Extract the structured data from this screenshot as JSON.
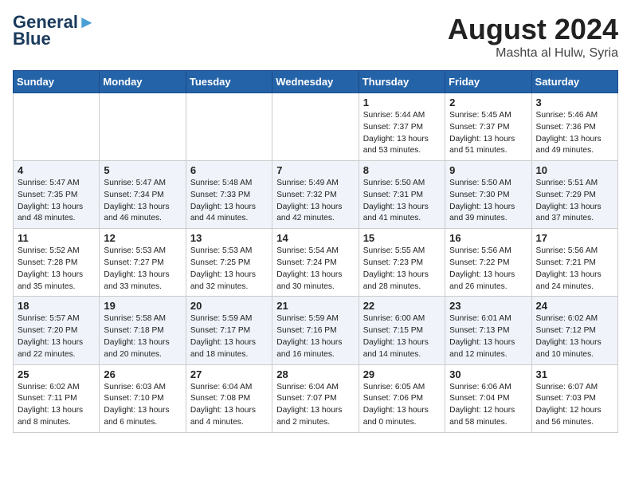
{
  "header": {
    "logo_line1": "General",
    "logo_line2": "Blue",
    "month": "August 2024",
    "location": "Mashta al Hulw, Syria"
  },
  "days_of_week": [
    "Sunday",
    "Monday",
    "Tuesday",
    "Wednesday",
    "Thursday",
    "Friday",
    "Saturday"
  ],
  "weeks": [
    [
      {
        "day": "",
        "info": ""
      },
      {
        "day": "",
        "info": ""
      },
      {
        "day": "",
        "info": ""
      },
      {
        "day": "",
        "info": ""
      },
      {
        "day": "1",
        "info": "Sunrise: 5:44 AM\nSunset: 7:37 PM\nDaylight: 13 hours\nand 53 minutes."
      },
      {
        "day": "2",
        "info": "Sunrise: 5:45 AM\nSunset: 7:37 PM\nDaylight: 13 hours\nand 51 minutes."
      },
      {
        "day": "3",
        "info": "Sunrise: 5:46 AM\nSunset: 7:36 PM\nDaylight: 13 hours\nand 49 minutes."
      }
    ],
    [
      {
        "day": "4",
        "info": "Sunrise: 5:47 AM\nSunset: 7:35 PM\nDaylight: 13 hours\nand 48 minutes."
      },
      {
        "day": "5",
        "info": "Sunrise: 5:47 AM\nSunset: 7:34 PM\nDaylight: 13 hours\nand 46 minutes."
      },
      {
        "day": "6",
        "info": "Sunrise: 5:48 AM\nSunset: 7:33 PM\nDaylight: 13 hours\nand 44 minutes."
      },
      {
        "day": "7",
        "info": "Sunrise: 5:49 AM\nSunset: 7:32 PM\nDaylight: 13 hours\nand 42 minutes."
      },
      {
        "day": "8",
        "info": "Sunrise: 5:50 AM\nSunset: 7:31 PM\nDaylight: 13 hours\nand 41 minutes."
      },
      {
        "day": "9",
        "info": "Sunrise: 5:50 AM\nSunset: 7:30 PM\nDaylight: 13 hours\nand 39 minutes."
      },
      {
        "day": "10",
        "info": "Sunrise: 5:51 AM\nSunset: 7:29 PM\nDaylight: 13 hours\nand 37 minutes."
      }
    ],
    [
      {
        "day": "11",
        "info": "Sunrise: 5:52 AM\nSunset: 7:28 PM\nDaylight: 13 hours\nand 35 minutes."
      },
      {
        "day": "12",
        "info": "Sunrise: 5:53 AM\nSunset: 7:27 PM\nDaylight: 13 hours\nand 33 minutes."
      },
      {
        "day": "13",
        "info": "Sunrise: 5:53 AM\nSunset: 7:25 PM\nDaylight: 13 hours\nand 32 minutes."
      },
      {
        "day": "14",
        "info": "Sunrise: 5:54 AM\nSunset: 7:24 PM\nDaylight: 13 hours\nand 30 minutes."
      },
      {
        "day": "15",
        "info": "Sunrise: 5:55 AM\nSunset: 7:23 PM\nDaylight: 13 hours\nand 28 minutes."
      },
      {
        "day": "16",
        "info": "Sunrise: 5:56 AM\nSunset: 7:22 PM\nDaylight: 13 hours\nand 26 minutes."
      },
      {
        "day": "17",
        "info": "Sunrise: 5:56 AM\nSunset: 7:21 PM\nDaylight: 13 hours\nand 24 minutes."
      }
    ],
    [
      {
        "day": "18",
        "info": "Sunrise: 5:57 AM\nSunset: 7:20 PM\nDaylight: 13 hours\nand 22 minutes."
      },
      {
        "day": "19",
        "info": "Sunrise: 5:58 AM\nSunset: 7:18 PM\nDaylight: 13 hours\nand 20 minutes."
      },
      {
        "day": "20",
        "info": "Sunrise: 5:59 AM\nSunset: 7:17 PM\nDaylight: 13 hours\nand 18 minutes."
      },
      {
        "day": "21",
        "info": "Sunrise: 5:59 AM\nSunset: 7:16 PM\nDaylight: 13 hours\nand 16 minutes."
      },
      {
        "day": "22",
        "info": "Sunrise: 6:00 AM\nSunset: 7:15 PM\nDaylight: 13 hours\nand 14 minutes."
      },
      {
        "day": "23",
        "info": "Sunrise: 6:01 AM\nSunset: 7:13 PM\nDaylight: 13 hours\nand 12 minutes."
      },
      {
        "day": "24",
        "info": "Sunrise: 6:02 AM\nSunset: 7:12 PM\nDaylight: 13 hours\nand 10 minutes."
      }
    ],
    [
      {
        "day": "25",
        "info": "Sunrise: 6:02 AM\nSunset: 7:11 PM\nDaylight: 13 hours\nand 8 minutes."
      },
      {
        "day": "26",
        "info": "Sunrise: 6:03 AM\nSunset: 7:10 PM\nDaylight: 13 hours\nand 6 minutes."
      },
      {
        "day": "27",
        "info": "Sunrise: 6:04 AM\nSunset: 7:08 PM\nDaylight: 13 hours\nand 4 minutes."
      },
      {
        "day": "28",
        "info": "Sunrise: 6:04 AM\nSunset: 7:07 PM\nDaylight: 13 hours\nand 2 minutes."
      },
      {
        "day": "29",
        "info": "Sunrise: 6:05 AM\nSunset: 7:06 PM\nDaylight: 13 hours\nand 0 minutes."
      },
      {
        "day": "30",
        "info": "Sunrise: 6:06 AM\nSunset: 7:04 PM\nDaylight: 12 hours\nand 58 minutes."
      },
      {
        "day": "31",
        "info": "Sunrise: 6:07 AM\nSunset: 7:03 PM\nDaylight: 12 hours\nand 56 minutes."
      }
    ]
  ]
}
